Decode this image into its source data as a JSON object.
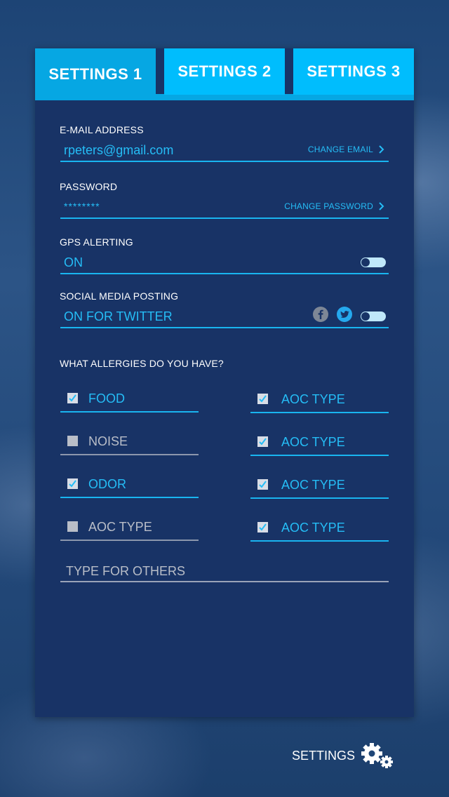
{
  "tabs": [
    {
      "label": "SETTINGS 1",
      "active": true
    },
    {
      "label": "SETTINGS 2",
      "active": false
    },
    {
      "label": "SETTINGS 3",
      "active": false
    }
  ],
  "email": {
    "label": "E-MAIL ADDRESS",
    "value": "rpeters@gmail.com",
    "action": "CHANGE EMAIL"
  },
  "password": {
    "label": "PASSWORD",
    "value": "********",
    "action": "CHANGE PASSWORD"
  },
  "gps": {
    "label": "GPS ALERTING",
    "value": "ON",
    "toggle_on": true
  },
  "social": {
    "label": "SOCIAL MEDIA POSTING",
    "value": "ON FOR TWITTER",
    "icons": [
      "facebook-icon",
      "twitter-icon"
    ],
    "toggle_on": true
  },
  "allergies": {
    "question": "WHAT ALLERGIES DO YOU HAVE?",
    "left": [
      {
        "label": "FOOD",
        "checked": true
      },
      {
        "label": "NOISE",
        "checked": false
      },
      {
        "label": "ODOR",
        "checked": true
      },
      {
        "label": "AOC TYPE",
        "checked": false
      }
    ],
    "right": [
      {
        "label": "AOC TYPE",
        "checked": true
      },
      {
        "label": "AOC TYPE",
        "checked": true
      },
      {
        "label": "AOC TYPE",
        "checked": true
      },
      {
        "label": "AOC TYPE",
        "checked": true
      }
    ],
    "others_placeholder": "TYPE FOR OTHERS"
  },
  "footer": {
    "label": "SETTINGS",
    "icon": "gears-icon"
  },
  "colors": {
    "accent": "#06a7e3",
    "tab": "#00bdfd",
    "card": "#183366",
    "text_accent": "#25bdf6"
  }
}
